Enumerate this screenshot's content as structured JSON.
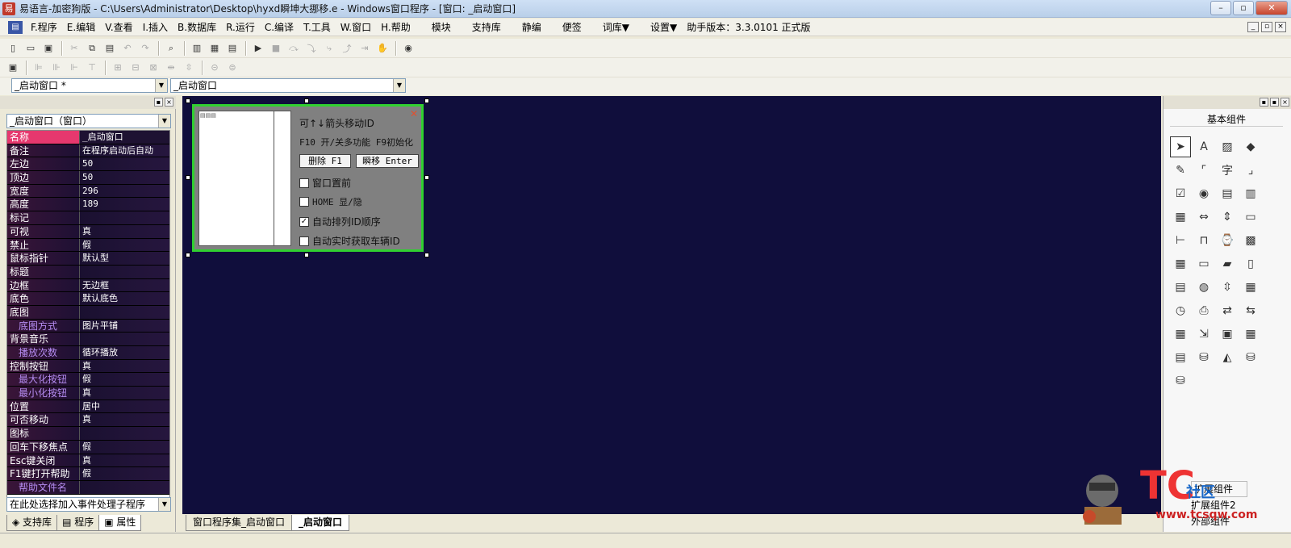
{
  "window": {
    "title": "易语言-加密狗版 - C:\\Users\\Administrator\\Desktop\\hyxd瞬坤大挪移.e - Windows窗口程序 - [窗口: _启动窗口]",
    "min": "–",
    "max": "▫",
    "close": "✕"
  },
  "menubar": {
    "items": [
      "F.程序",
      "E.编辑",
      "V.查看",
      "I.插入",
      "B.数据库",
      "R.运行",
      "C.编译",
      "T.工具",
      "W.窗口",
      "H.帮助"
    ],
    "extra": [
      "模块",
      "支持库",
      "静编",
      "便签",
      "词库▼",
      "设置▼",
      "助手版本：3.3.0101 正式版"
    ]
  },
  "combos": {
    "left": "_启动窗口 *",
    "right": "_启动窗口",
    "object": "_启动窗口（窗口）",
    "event": "在此处选择加入事件处理子程序"
  },
  "properties": [
    {
      "name": "名称",
      "value": "_启动窗口",
      "selected": true
    },
    {
      "name": "备注",
      "value": "在程序启动后自动"
    },
    {
      "name": "左边",
      "value": "50"
    },
    {
      "name": "顶边",
      "value": "50"
    },
    {
      "name": "宽度",
      "value": "296"
    },
    {
      "name": "高度",
      "value": "189"
    },
    {
      "name": "标记",
      "value": ""
    },
    {
      "name": "可视",
      "value": "真"
    },
    {
      "name": "禁止",
      "value": "假"
    },
    {
      "name": "鼠标指针",
      "value": "默认型"
    },
    {
      "name": "标题",
      "value": ""
    },
    {
      "name": "边框",
      "value": "无边框"
    },
    {
      "name": "底色",
      "value": "默认底色"
    },
    {
      "name": "底图",
      "value": ""
    },
    {
      "name": "底图方式",
      "value": "图片平铺",
      "sub": true
    },
    {
      "name": "背景音乐",
      "value": ""
    },
    {
      "name": "播放次数",
      "value": "循环播放",
      "sub": true
    },
    {
      "name": "控制按钮",
      "value": "真"
    },
    {
      "name": "最大化按钮",
      "value": "假",
      "sub": true
    },
    {
      "name": "最小化按钮",
      "value": "真",
      "sub": true
    },
    {
      "name": "位置",
      "value": "居中"
    },
    {
      "name": "可否移动",
      "value": "真"
    },
    {
      "name": "图标",
      "value": ""
    },
    {
      "name": "回车下移焦点",
      "value": "假"
    },
    {
      "name": "Esc键关闭",
      "value": "真"
    },
    {
      "name": "F1键打开帮助",
      "value": "假"
    },
    {
      "name": "帮助文件名",
      "value": "",
      "sub": true
    }
  ],
  "left_tabs": [
    "支持库",
    "程序",
    "属性"
  ],
  "bottom_tabs": [
    "窗口程序集_启动窗口",
    "_启动窗口"
  ],
  "right_panel": {
    "title": "基本组件",
    "ext1": "扩展组件",
    "ext2": "扩展组件2",
    "ext3": "外部组件"
  },
  "form": {
    "label1": "可↑↓箭头移动ID",
    "label2": "F10 开/关多功能 F9初始化",
    "btn_delete": "删除 F1",
    "btn_teleport": "瞬移 Enter",
    "chk": [
      {
        "label": "窗口置前",
        "checked": false
      },
      {
        "label": "HOME 显/隐",
        "checked": false
      },
      {
        "label": "自动排列ID顺序",
        "checked": true
      },
      {
        "label": "自动实时获取车辆ID",
        "checked": false
      }
    ]
  },
  "watermark": {
    "logo": "TC",
    "zone": "社区",
    "url": "www.tcsqw.com"
  }
}
